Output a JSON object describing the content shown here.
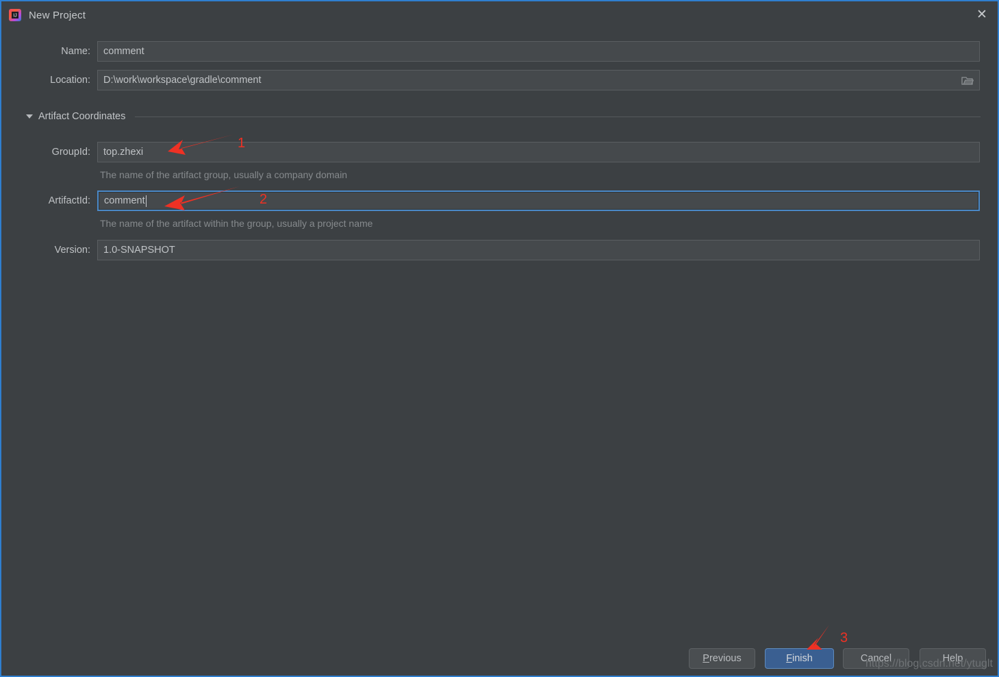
{
  "window": {
    "title": "New Project",
    "app_icon": "intellij-idea-icon",
    "close_icon": "close-icon",
    "border_color": "#2f7fd0",
    "background_color": "#3c4043"
  },
  "form": {
    "name": {
      "label": "Name:",
      "value": "comment",
      "placeholder": ""
    },
    "location": {
      "label": "Location:",
      "value": "D:\\work\\workspace\\gradle\\comment",
      "placeholder": "",
      "browse_icon": "folder-icon"
    }
  },
  "section": {
    "title": "Artifact Coordinates",
    "expanded": true,
    "toggle_icon": "triangle-down-icon",
    "fields": {
      "group_id": {
        "label": "GroupId:",
        "value": "top.zhexi",
        "hint": "The name of the artifact group, usually a company domain",
        "focused": false
      },
      "artifact_id": {
        "label": "ArtifactId:",
        "value": "comment",
        "hint": "The name of the artifact within the group, usually a project name",
        "focused": true
      },
      "version": {
        "label": "Version:",
        "value": "1.0-SNAPSHOT",
        "hint": "",
        "focused": false
      }
    }
  },
  "buttons": {
    "previous": {
      "label": "Previous",
      "mnemonic": "P",
      "primary": false
    },
    "finish": {
      "label": "Finish",
      "mnemonic": "F",
      "primary": true
    },
    "cancel": {
      "label": "Cancel",
      "mnemonic": "",
      "primary": false
    },
    "help": {
      "label": "Help",
      "mnemonic": "",
      "primary": false
    }
  },
  "annotations": {
    "color": "#ee3124",
    "markers": [
      {
        "number": "1",
        "target": "group-id-field"
      },
      {
        "number": "2",
        "target": "artifact-id-field"
      },
      {
        "number": "3",
        "target": "finish-button"
      }
    ]
  },
  "watermark": {
    "text": "https://blog.csdn.net/ytuglt"
  }
}
